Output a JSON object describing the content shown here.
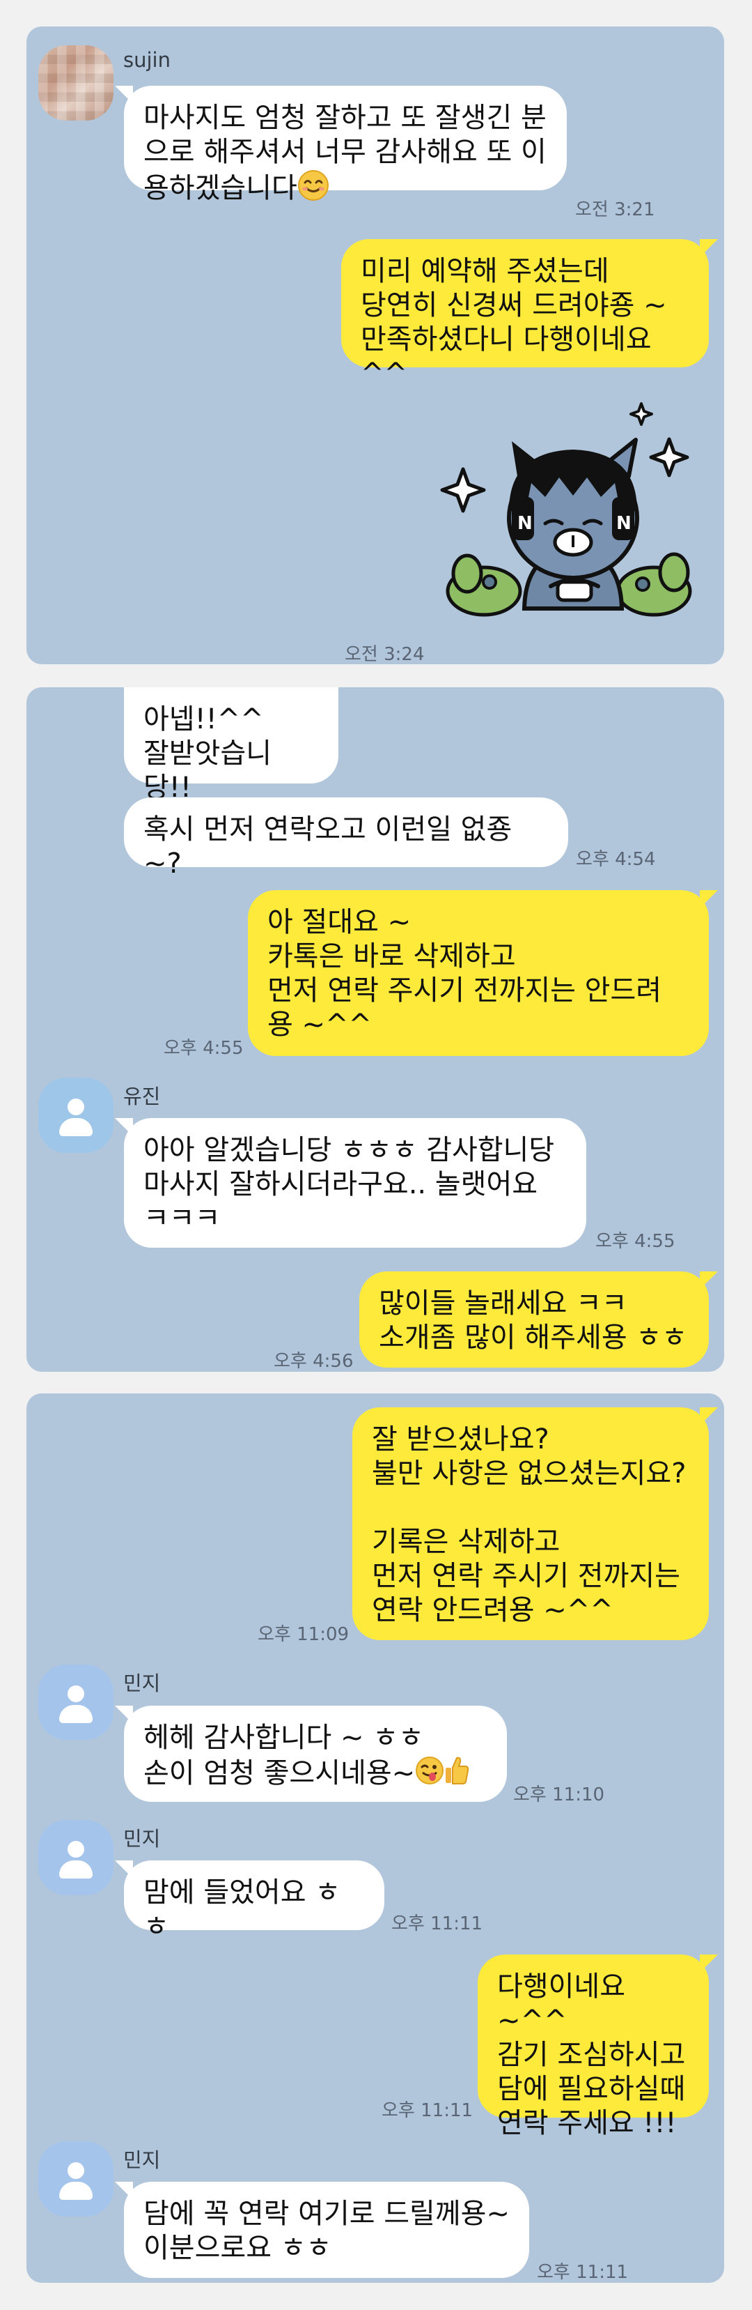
{
  "card1": {
    "sender_name": "sujin",
    "msg1": {
      "text": "마사지도 엄청 잘하고 또 잘생긴 분\n으로 해주셔서 너무 감사해요 또 이\n용하겠습니다",
      "emoji": "smiling-face-icon",
      "time": "오전 3:21"
    },
    "msg2": {
      "text": "미리 예약해 주셨는데\n당연히 신경써 드려야죵 ~\n만족하셨다니 다행이네요 ^^"
    },
    "sticker": {
      "icon": "kakao-neo-sticker-icon",
      "time": "오전 3:24"
    }
  },
  "card2": {
    "msg1": {
      "text": "아넵!!^^\n잘받앗습니당!!"
    },
    "msg2": {
      "text": "혹시 먼저 연락오고 이런일 없죵~?",
      "time": "오후 4:54"
    },
    "msg3": {
      "text": "아 절대요 ~\n카톡은 바로 삭제하고\n먼저 연락 주시기 전까지는 안드려\n용 ~^^",
      "time": "오후 4:55"
    },
    "sender_name": "유진",
    "msg4": {
      "text": "아아 알겠습니당 ㅎㅎㅎ 감사합니당\n마사지 잘하시더라구요.. 놀랫어요\nㅋㅋㅋ",
      "time": "오후 4:55"
    },
    "msg5": {
      "text": "많이들 놀래세요 ㅋㅋ\n소개좀 많이 해주세용 ㅎㅎ",
      "time": "오후 4:56"
    }
  },
  "card3": {
    "msg1": {
      "text": "잘 받으셨나요?\n불만 사항은 없으셨는지요?\n\n기록은 삭제하고\n먼저 연락 주시기 전까지는\n연락 안드려용 ~^^",
      "time": "오후 11:09"
    },
    "sender_name": "민지",
    "msg2": {
      "text": "헤헤 감사합니다 ~ ㅎㅎ\n손이 엄청 좋으시네용~",
      "emoji1": "winking-tongue-face-icon",
      "emoji2": "thumbs-up-icon",
      "time": "오후 11:10"
    },
    "msg3": {
      "text": "맘에 들었어요 ㅎㅎ",
      "time": "오후 11:11"
    },
    "msg4": {
      "text": "다행이네요 ~^^\n감기 조심하시고\n담에 필요하실때\n연락 주세요 !!!",
      "time": "오후 11:11"
    },
    "msg5": {
      "text": "담에 꼭 연락 여기로 드릴께용~\n이분으로요 ㅎㅎ",
      "time": "오후 11:11"
    }
  }
}
